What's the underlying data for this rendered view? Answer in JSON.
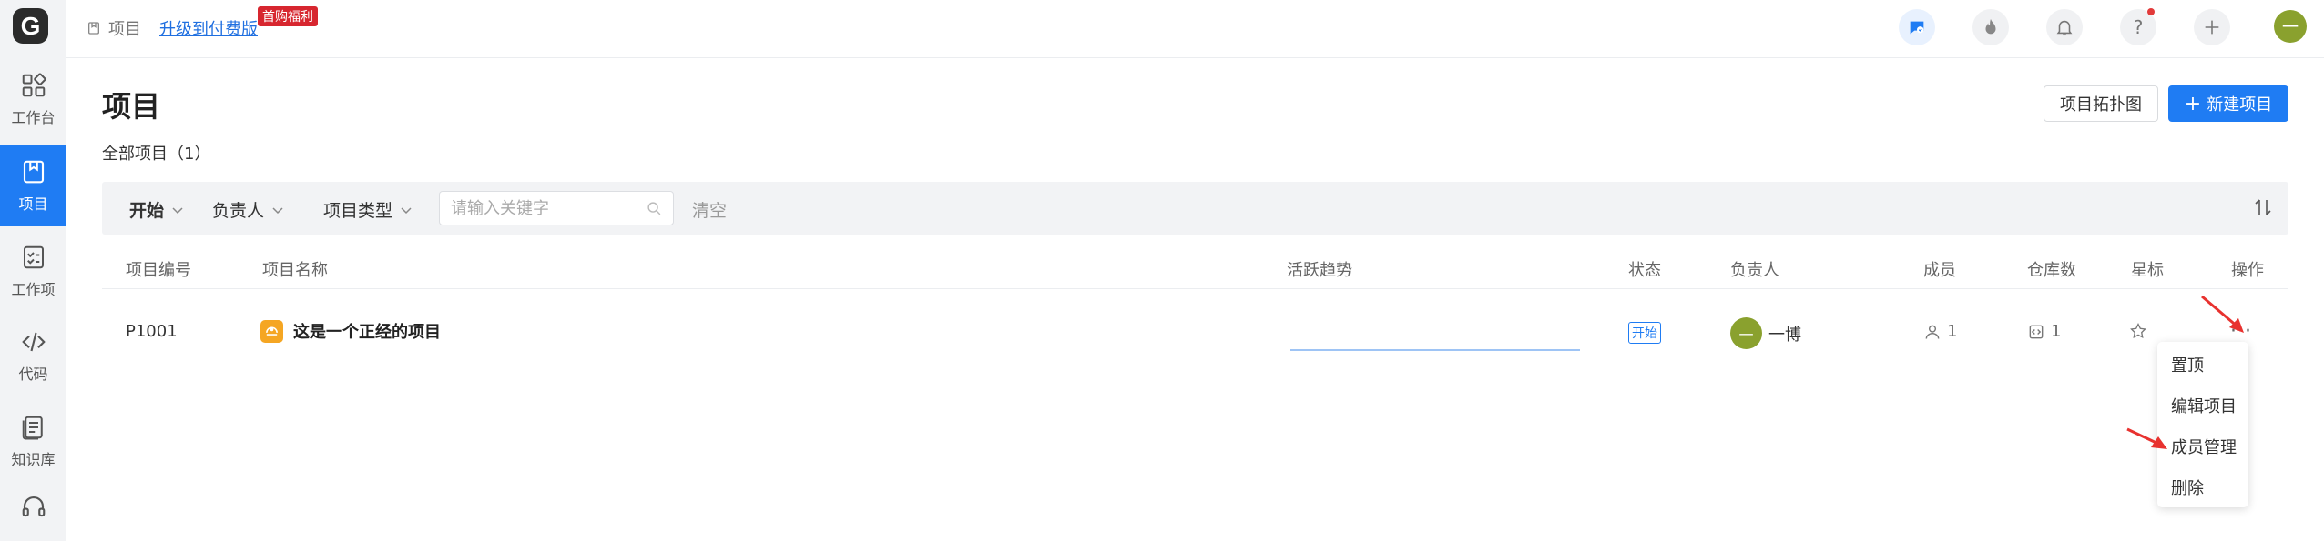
{
  "sidebar": {
    "logo": "G",
    "items": [
      {
        "label": "工作台",
        "icon": "dashboard-icon"
      },
      {
        "label": "项目",
        "icon": "project-icon",
        "active": true
      },
      {
        "label": "工作项",
        "icon": "workitem-icon"
      },
      {
        "label": "代码",
        "icon": "code-icon"
      },
      {
        "label": "知识库",
        "icon": "knowledge-icon"
      },
      {
        "icon": "headset-icon"
      }
    ]
  },
  "topbar": {
    "breadcrumb": "项目",
    "upgrade_link": "升级到付费版",
    "promo_badge": "首购福利",
    "avatar_text": "一"
  },
  "header": {
    "title": "项目",
    "count_label": "全部项目（1）",
    "topology_button": "项目拓扑图",
    "new_button": "新建项目"
  },
  "filters": {
    "start": "开始",
    "owner": "负责人",
    "type": "项目类型",
    "search_placeholder": "请输入关键字",
    "clear": "清空"
  },
  "table": {
    "columns": [
      "项目编号",
      "项目名称",
      "活跃趋势",
      "状态",
      "负责人",
      "成员",
      "仓库数",
      "星标",
      "操作"
    ],
    "rows": [
      {
        "id": "P1001",
        "name": "这是一个正经的项目",
        "status": "开始",
        "owner_avatar": "一",
        "owner": "一博",
        "members": "1",
        "repos": "1"
      }
    ]
  },
  "menu": {
    "items": [
      "置顶",
      "编辑项目",
      "成员管理",
      "删除"
    ]
  },
  "colors": {
    "primary": "#1f7cf3",
    "sidebar_bg": "#f2f3f5",
    "avatar": "#8aa12e",
    "project_icon": "#f5a623",
    "promo": "#d7262f",
    "annotation_arrow": "#e8322f"
  }
}
